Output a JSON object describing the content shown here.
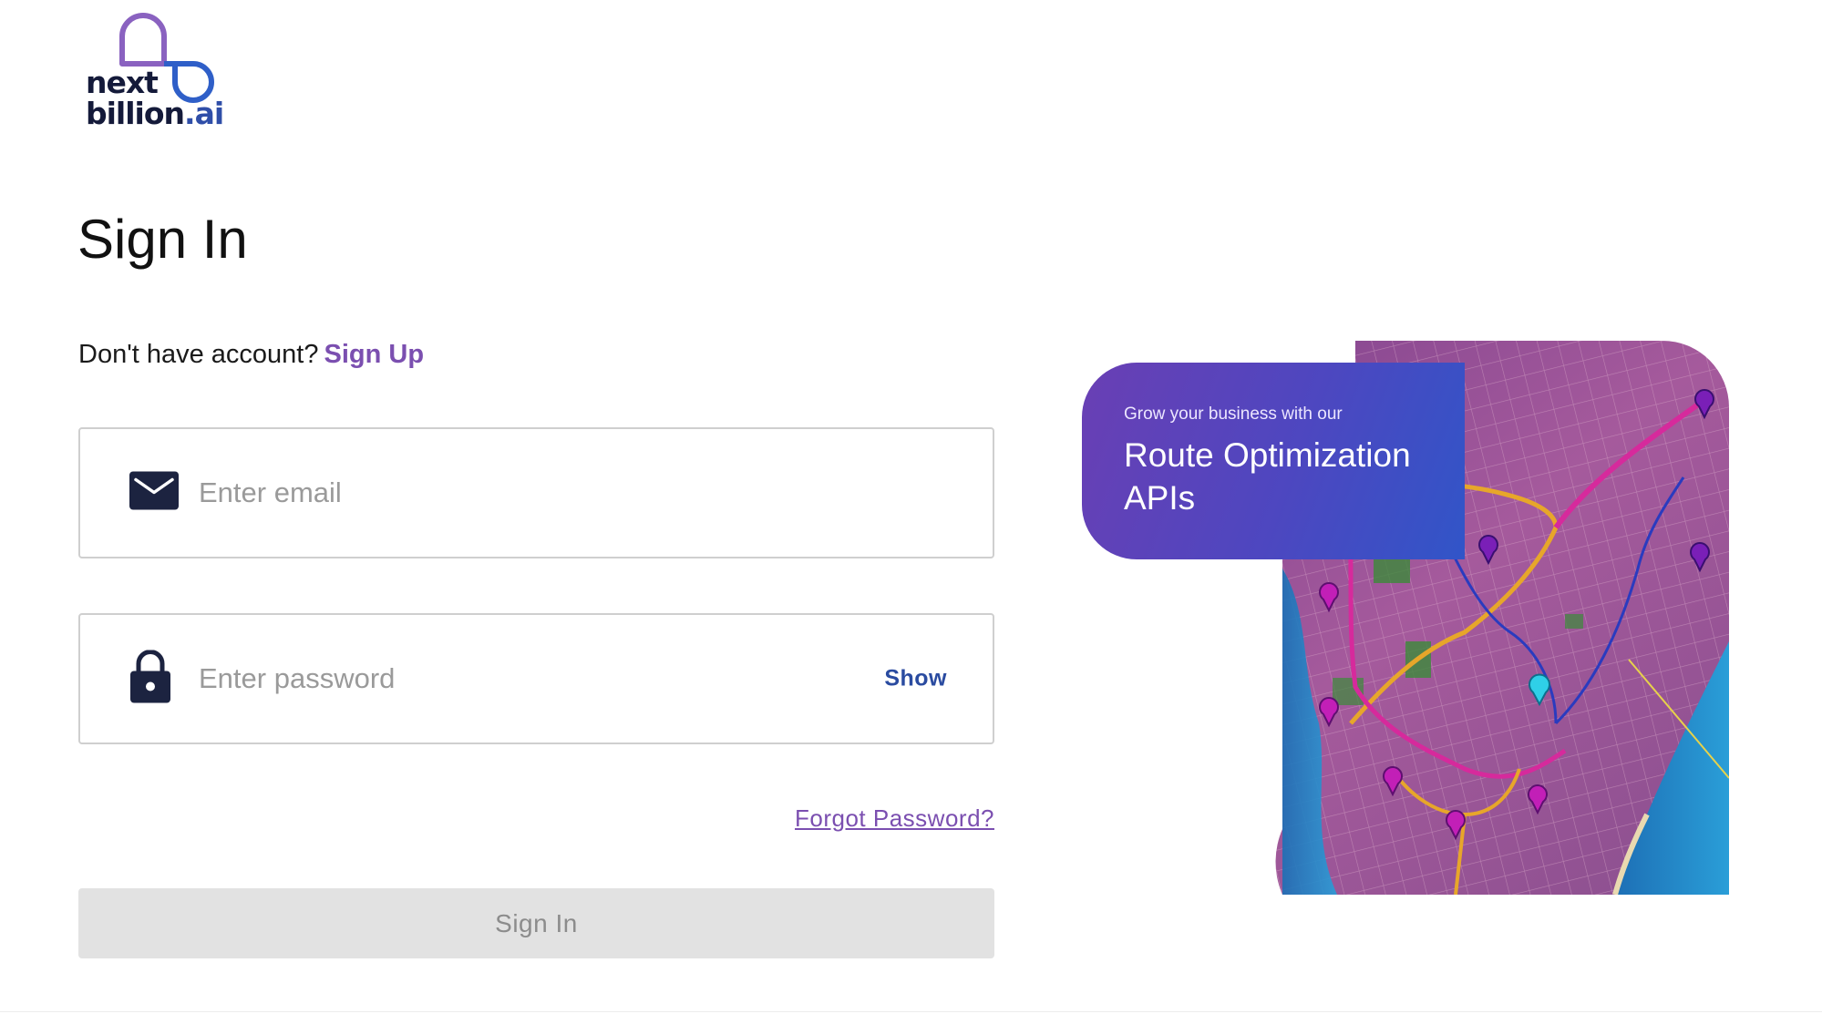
{
  "brand": {
    "line1": "next",
    "line2": "billion",
    "line2_suffix": ".ai"
  },
  "page": {
    "title": "Sign In"
  },
  "signup": {
    "prompt": "Don't have account?",
    "link_label": "Sign Up"
  },
  "email": {
    "placeholder": "Enter email",
    "value": ""
  },
  "password": {
    "placeholder": "Enter password",
    "value": "",
    "toggle_label": "Show"
  },
  "forgot": {
    "label": "Forgot Password?"
  },
  "submit": {
    "label": "Sign In"
  },
  "promo": {
    "kicker": "Grow your business with our",
    "title": "Route Optimization APIs"
  },
  "colors": {
    "brand_purple": "#7b4fb0",
    "brand_blue": "#2a4ba0",
    "promo_gradient_start": "#6a3fb4",
    "promo_gradient_end": "#3155c8",
    "disabled_button": "#e2e2e2"
  },
  "icons": {
    "email": "envelope-icon",
    "password": "lock-icon"
  }
}
